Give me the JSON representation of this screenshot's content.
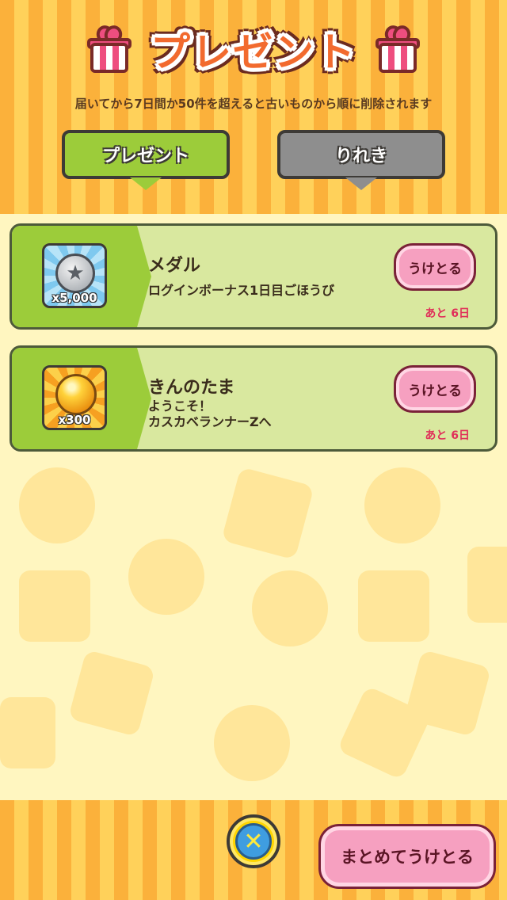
{
  "header": {
    "title": "プレゼント",
    "notice": "届いてから7日間か50件を超えると古いものから順に削除されます"
  },
  "tabs": [
    {
      "label": "プレゼント",
      "active": true
    },
    {
      "label": "りれき",
      "active": false
    }
  ],
  "presents": [
    {
      "name": "メダル",
      "icon": "medal-icon",
      "quantity": "x5,000",
      "description_lines": [
        "ログインボーナス1日目ごほうび"
      ],
      "button": "うけとる",
      "remaining": "あと 6日"
    },
    {
      "name": "きんのたま",
      "icon": "gold-ball-icon",
      "quantity": "x300",
      "description_lines": [
        "ようこそ！",
        "カスカベランナーZへ"
      ],
      "button": "うけとる",
      "remaining": "あと 6日"
    }
  ],
  "footer": {
    "close_icon": "close-icon",
    "receive_all": "まとめてうけとる"
  },
  "colors": {
    "stripe_orange": "#fbb13b",
    "stripe_yellow": "#ffd15a",
    "tab_active": "#9ccc3a",
    "tab_inactive": "#8e8e8e",
    "button_pink": "#f6a0c0",
    "remaining_red": "#e0305a"
  }
}
